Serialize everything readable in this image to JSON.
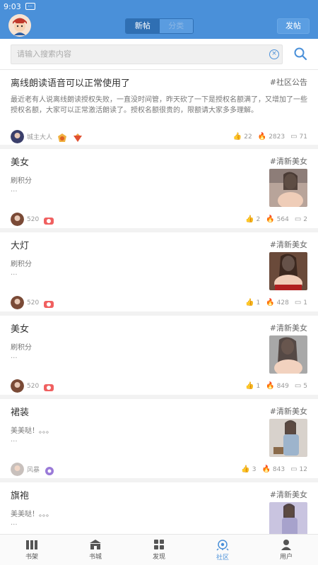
{
  "status": {
    "time": "9:03"
  },
  "header": {
    "seg_new": "新帖",
    "seg_category": "分类",
    "post_button": "发帖"
  },
  "search": {
    "placeholder": "请输入搜索内容"
  },
  "posts": [
    {
      "title": "离线朗读语音可以正常使用了",
      "tag": "#社区公告",
      "body": "最近老有人说离线朗读授权失败，一直没时间管，昨天砍了一下是授权名额满了，又增加了一些授权名额，大家可以正常激活朗读了。授权名额很贵的，限额请大家多多理解。",
      "author": "城主大人",
      "likes": "22",
      "hot": "2823",
      "comments": "71"
    },
    {
      "title": "美女",
      "tag": "#清新美女",
      "body": "刷积分",
      "ellipsis": "...",
      "author": "520",
      "likes": "2",
      "hot": "564",
      "comments": "2"
    },
    {
      "title": "大灯",
      "tag": "#清新美女",
      "body": "刷积分",
      "ellipsis": "...",
      "author": "520",
      "likes": "1",
      "hot": "428",
      "comments": "1"
    },
    {
      "title": "美女",
      "tag": "#清新美女",
      "body": "刷积分",
      "ellipsis": "...",
      "author": "520",
      "likes": "1",
      "hot": "849",
      "comments": "5"
    },
    {
      "title": "裙装",
      "tag": "#清新美女",
      "body": "美美哒！。。。",
      "ellipsis": "...",
      "author": "风暴",
      "likes": "3",
      "hot": "843",
      "comments": "12"
    },
    {
      "title": "旗袍",
      "tag": "#清新美女",
      "body": "美美哒！。。。",
      "ellipsis": "..."
    }
  ],
  "tabs": [
    {
      "label": "书架",
      "icon": "bookshelf-icon"
    },
    {
      "label": "书城",
      "icon": "bookstore-icon"
    },
    {
      "label": "发现",
      "icon": "discover-icon"
    },
    {
      "label": "社区",
      "icon": "community-icon"
    },
    {
      "label": "用户",
      "icon": "user-icon"
    }
  ],
  "colors": {
    "accent": "#4a90d9",
    "active_tab": "#4a90d9"
  }
}
